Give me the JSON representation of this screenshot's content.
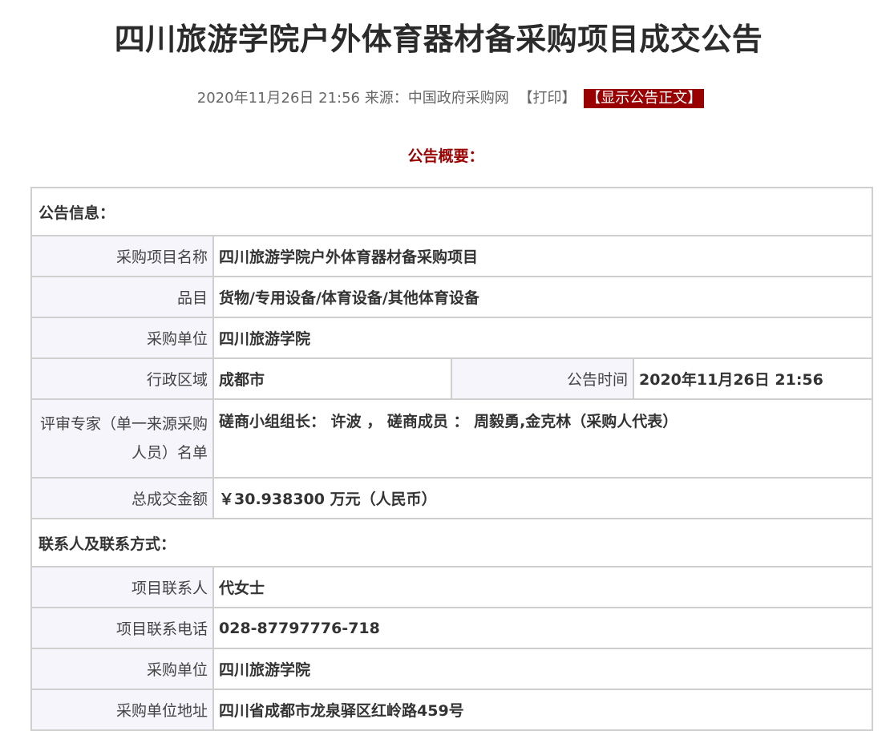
{
  "page": {
    "title": "四川旅游学院户外体育器材备采购项目成交公告"
  },
  "meta": {
    "datetime": "2020年11月26日 21:56",
    "source_label": "来源：",
    "source": "中国政府采购网",
    "print_label": "【打印】",
    "show_body_label": "【显示公告正文】"
  },
  "summary": {
    "heading": "公告概要："
  },
  "announcement_info": {
    "section_title": "公告信息：",
    "project_name_label": "采购项目名称",
    "project_name": "四川旅游学院户外体育器材备采购项目",
    "category_label": "品目",
    "category": "货物/专用设备/体育设备/其他体育设备",
    "purchaser_label": "采购单位",
    "purchaser": "四川旅游学院",
    "region_label": "行政区域",
    "region": "成都市",
    "announce_time_label": "公告时间",
    "announce_time": "2020年11月26日 21:56",
    "experts_label": "评审专家（单一来源采购人员）名单",
    "experts": "磋商小组组长： 许波 ， 磋商成员 ： 周毅勇,金克林（采购人代表）",
    "total_amount_label": "总成交金额",
    "total_amount": "￥30.938300 万元（人民币）"
  },
  "contact_info": {
    "section_title": "联系人及联系方式：",
    "contact_person_label": "项目联系人",
    "contact_person": "代女士",
    "contact_phone_label": "项目联系电话",
    "contact_phone": "028-87797776-718",
    "purchaser_label": "采购单位",
    "purchaser": "四川旅游学院",
    "purchaser_address_label": "采购单位地址",
    "purchaser_address": "四川省成都市龙泉驿区红岭路459号"
  }
}
